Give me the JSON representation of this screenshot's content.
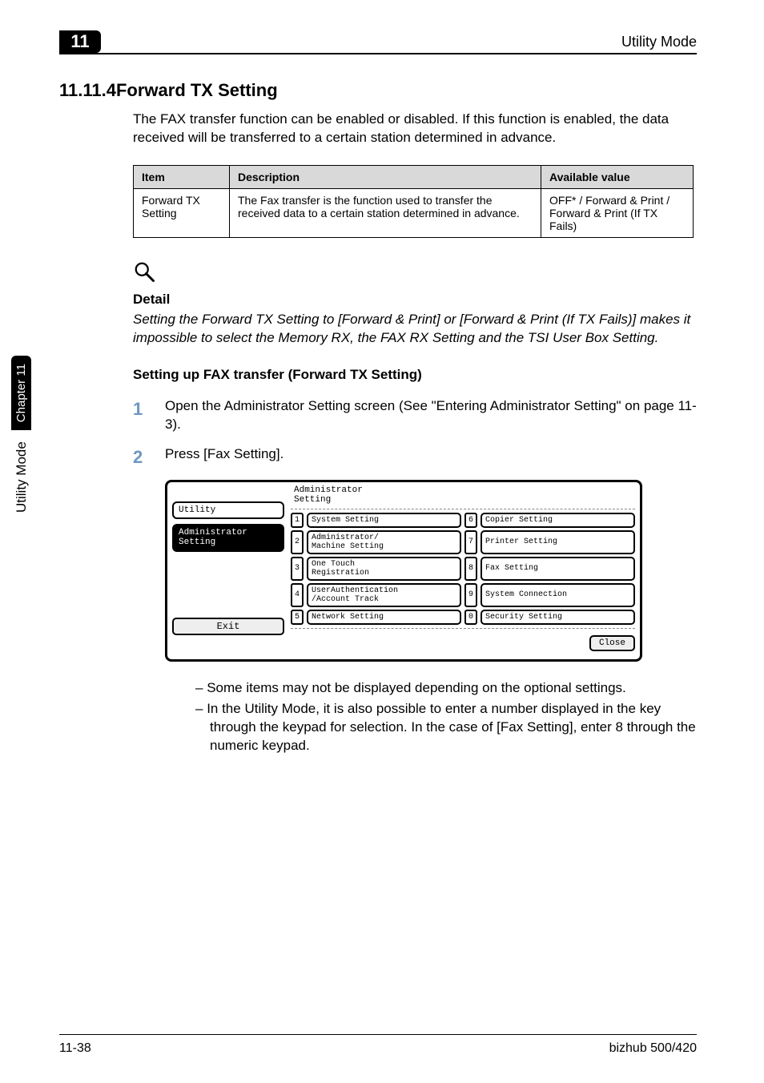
{
  "header": {
    "corner_number": "11",
    "top_right": "Utility Mode"
  },
  "section": {
    "heading": "11.11.4Forward TX Setting",
    "intro": "The FAX transfer function can be enabled or disabled. If this function is enabled, the data received will be transferred to a certain station determined in advance."
  },
  "table": {
    "headers": {
      "item": "Item",
      "description": "Description",
      "available": "Available value"
    },
    "row": {
      "item": "Forward TX Setting",
      "description": "The Fax transfer is the function used to transfer the received data to a certain station determined in advance.",
      "available": "OFF* / Forward & Print / Forward & Print (If TX Fails)"
    }
  },
  "detail": {
    "label": "Detail",
    "text": "Setting the Forward TX Setting to [Forward & Print] or [Forward & Print (If TX Fails)] makes it impossible to select the Memory RX, the FAX RX Setting and the TSI User Box Setting."
  },
  "subheading": "Setting up FAX transfer (Forward TX Setting)",
  "steps": {
    "s1": "Open the Administrator Setting screen (See \"Entering Administrator Setting\" on page 11-3).",
    "s2": "Press [Fax Setting]."
  },
  "ui": {
    "sidebar": {
      "utility": "Utility",
      "admin": "Administrator\nSetting"
    },
    "title": "Administrator\nSetting",
    "buttons": {
      "b1": "System Setting",
      "b2": "Administrator/\nMachine Setting",
      "b3": "One Touch\nRegistration",
      "b4": "UserAuthentication\n/Account Track",
      "b5": "Network Setting",
      "b6": "Copier Setting",
      "b7": "Printer Setting",
      "b8": "Fax Setting",
      "b9": "System Connection",
      "b0": "Security Setting"
    },
    "nums": {
      "n1": "1",
      "n2": "2",
      "n3": "3",
      "n4": "4",
      "n5": "5",
      "n6": "6",
      "n7": "7",
      "n8": "8",
      "n9": "9",
      "n0": "0"
    },
    "exit": "Exit",
    "close": "Close"
  },
  "bullets": {
    "b1": "Some items may not be displayed depending on the optional settings.",
    "b2": "In the Utility Mode, it is also possible to enter a number displayed in the key through the keypad for selection. In the case of [Fax Setting], enter 8 through the numeric keypad."
  },
  "footer": {
    "left": "11-38",
    "right": "bizhub 500/420"
  },
  "sidetab": {
    "main": "Utility Mode",
    "chapter": "Chapter 11"
  }
}
